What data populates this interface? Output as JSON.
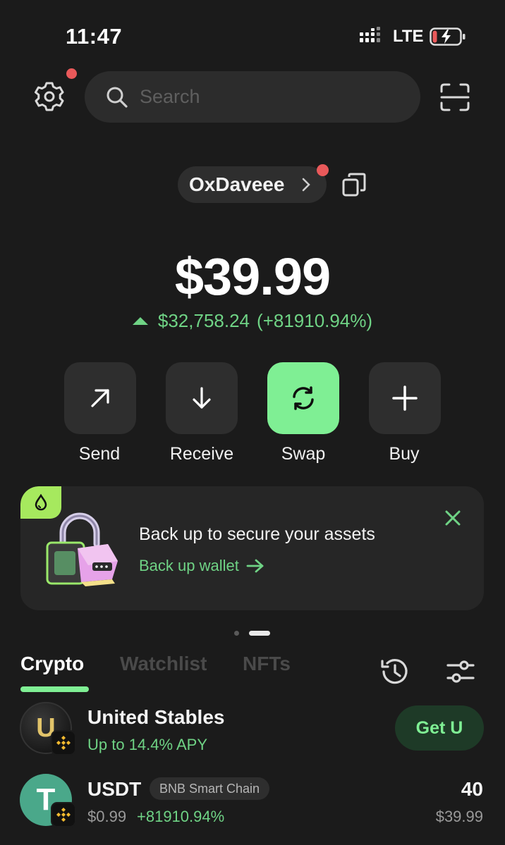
{
  "status_bar": {
    "time": "11:47",
    "network": "LTE",
    "icons": [
      "signal-icon",
      "battery-charging-icon"
    ]
  },
  "header": {
    "search_placeholder": "Search",
    "icons": [
      "gear-icon",
      "search-icon",
      "scan-icon"
    ]
  },
  "account": {
    "name": "OxDaveee",
    "icons": [
      "chevron-right-icon",
      "copy-icon"
    ]
  },
  "portfolio": {
    "balance": "$39.99",
    "change_amount": "$32,758.24",
    "change_percent": "(+81910.94%)",
    "change_color": "#6fd385"
  },
  "actions": [
    {
      "label": "Send",
      "icon": "arrow-up-right-icon"
    },
    {
      "label": "Receive",
      "icon": "arrow-down-icon"
    },
    {
      "label": "Swap",
      "icon": "swap-icon"
    },
    {
      "label": "Buy",
      "icon": "plus-icon"
    }
  ],
  "banner": {
    "title": "Back up to secure your assets",
    "link": "Back up wallet",
    "icons": [
      "drop-icon",
      "close-icon",
      "arrow-right-icon"
    ]
  },
  "carousel": {
    "pages": 2,
    "active": 2
  },
  "tabs": [
    {
      "label": "Crypto",
      "active": true
    },
    {
      "label": "Watchlist",
      "active": false
    },
    {
      "label": "NFTs",
      "active": false
    }
  ],
  "tab_icons": [
    "history-icon",
    "filter-icon"
  ],
  "tokens": [
    {
      "name": "United Stables",
      "subtitle": "Up to 14.4% APY",
      "action": "Get U",
      "logo": "U",
      "chain_icon": "bnb-icon"
    },
    {
      "name": "USDT",
      "chain": "BNB Smart Chain",
      "price": "$0.99",
      "change": "+81910.94%",
      "amount": "40",
      "value": "$39.99",
      "logo": "T",
      "chain_icon": "bnb-icon"
    }
  ],
  "colors": {
    "background": "#1b1b1b",
    "accent": "#7fef94",
    "positive": "#6fd385",
    "alert": "#e9595a",
    "card": "#2e2e2e"
  }
}
